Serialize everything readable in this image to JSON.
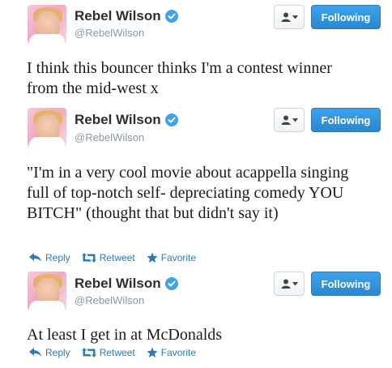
{
  "colors": {
    "accent": "#2b7bb9",
    "follow_bg": "#3fa2ea",
    "handle": "#8899a6",
    "name": "#292f33"
  },
  "tweets": [
    {
      "author": {
        "name": "Rebel Wilson",
        "handle": "@RebelWilson",
        "verified": true,
        "avatar": "profile-photo"
      },
      "buttons": {
        "user_menu_icon": "person-icon",
        "follow_label": "Following"
      },
      "text": "I think this bouncer thinks I'm a contest winner from the mid-west x",
      "actions": []
    },
    {
      "author": {
        "name": "Rebel Wilson",
        "handle": "@RebelWilson",
        "verified": true,
        "avatar": "profile-photo"
      },
      "buttons": {
        "user_menu_icon": "person-icon",
        "follow_label": "Following"
      },
      "text": "\"I'm in a very cool movie about acappella singing full of top-notch self- depreciating comedy YOU BITCH\" (thought that but didn't say it)",
      "actions": [
        {
          "label": "Reply",
          "icon": "reply-icon"
        },
        {
          "label": "Retweet",
          "icon": "retweet-icon"
        },
        {
          "label": "Favorite",
          "icon": "star-icon"
        }
      ]
    },
    {
      "author": {
        "name": "Rebel Wilson",
        "handle": "@RebelWilson",
        "verified": true,
        "avatar": "profile-photo"
      },
      "buttons": {
        "user_menu_icon": "person-icon",
        "follow_label": "Following"
      },
      "text": "At least I get in at McDonalds",
      "actions": [
        {
          "label": "Reply",
          "icon": "reply-icon"
        },
        {
          "label": "Retweet",
          "icon": "retweet-icon"
        },
        {
          "label": "Favorite",
          "icon": "star-icon"
        }
      ]
    }
  ]
}
